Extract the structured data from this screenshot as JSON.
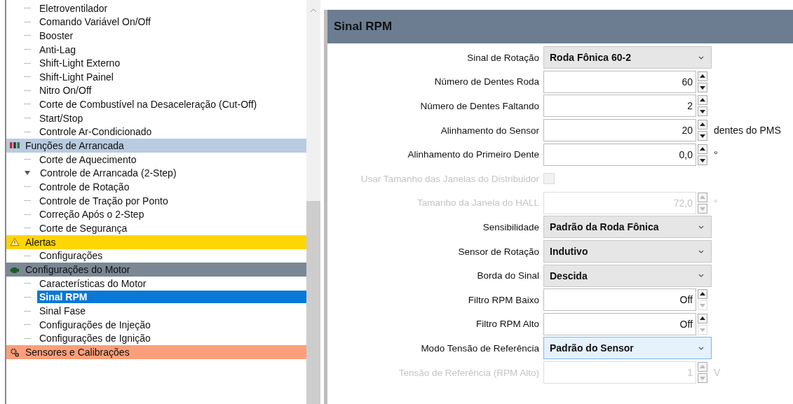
{
  "tree": [
    {
      "children": [
        {
          "label": "Eletroventilador",
          "expanded": false,
          "selected": false
        },
        {
          "label": "Comando Variável On/Off",
          "expanded": false,
          "selected": false
        },
        {
          "label": "Booster",
          "expanded": false,
          "selected": false
        },
        {
          "label": "Anti-Lag",
          "expanded": false,
          "selected": false
        },
        {
          "label": "Shift-Light Externo",
          "expanded": false,
          "selected": false
        },
        {
          "label": "Shift-Light Painel",
          "expanded": false,
          "selected": false
        },
        {
          "label": "Nitro On/Off",
          "expanded": false,
          "selected": false
        },
        {
          "label": "Corte de Combustível na Desaceleração (Cut-Off)",
          "expanded": false,
          "selected": false
        },
        {
          "label": "Start/Stop",
          "expanded": false,
          "selected": false
        },
        {
          "label": "Controle Ar-Condicionado",
          "expanded": false,
          "selected": false
        }
      ]
    },
    {
      "label": "Funções de Arrancada",
      "color": "#b9cbe0",
      "children": [
        {
          "label": "Corte de Aquecimento",
          "expanded": false,
          "selected": false
        },
        {
          "label": "Controle de Arrancada (2-Step)",
          "expanded": true,
          "selected": false
        },
        {
          "label": "Controle de Rotação",
          "expanded": false,
          "selected": false
        },
        {
          "label": "Controle de Tração por Ponto",
          "expanded": false,
          "selected": false
        },
        {
          "label": "Correção Após o 2-Step",
          "expanded": false,
          "selected": false
        },
        {
          "label": "Corte de Segurança",
          "expanded": false,
          "selected": false
        }
      ]
    },
    {
      "label": "Alertas",
      "color": "#fdd500",
      "children": [
        {
          "label": "Configurações",
          "expanded": false,
          "selected": false
        }
      ]
    },
    {
      "label": "Configurações do Motor",
      "color": "#7b8794",
      "children": [
        {
          "label": "Características do Motor",
          "expanded": false,
          "selected": false
        },
        {
          "label": "Sinal RPM",
          "expanded": false,
          "selected": true
        },
        {
          "label": "Sinal Fase",
          "expanded": false,
          "selected": false
        },
        {
          "label": "Configurações de Injeção",
          "expanded": false,
          "selected": false
        },
        {
          "label": "Configurações de Ignição",
          "expanded": false,
          "selected": false
        }
      ]
    },
    {
      "label": "Sensores e Calibrações",
      "color": "#fb9f7a"
    }
  ],
  "panel": {
    "title": "Sinal RPM",
    "rows": [
      {
        "kind": "select",
        "label": "Sinal de Rotação",
        "value": "Roda Fônica 60-2",
        "disabled": false,
        "focused": false
      },
      {
        "kind": "spin",
        "label": "Número de Dentes Roda",
        "value": "60",
        "disabled": false,
        "down_disabled": false
      },
      {
        "kind": "spin",
        "label": "Número de Dentes Faltando",
        "value": "2",
        "disabled": false,
        "down_disabled": false
      },
      {
        "kind": "spin",
        "label": "Alinhamento do Sensor",
        "value": "20",
        "unit": "dentes do PMS",
        "disabled": false,
        "down_disabled": false
      },
      {
        "kind": "spin",
        "label": "Alinhamento do Primeiro Dente",
        "value": "0,0",
        "unit": "°",
        "disabled": false,
        "down_disabled": false
      },
      {
        "kind": "checkbox",
        "label": "Usar Tamanho das Janelas do Distribuidor",
        "checked": false,
        "disabled": true
      },
      {
        "kind": "spin",
        "label": "Tamanho da Janela do HALL",
        "value": "72,0",
        "unit": "°",
        "disabled": true
      },
      {
        "kind": "select",
        "label": "Sensibilidade",
        "value": "Padrão da Roda Fônica",
        "disabled": false,
        "focused": false
      },
      {
        "kind": "select",
        "label": "Sensor de Rotação",
        "value": "Indutivo",
        "disabled": false,
        "focused": false
      },
      {
        "kind": "select",
        "label": "Borda do Sinal",
        "value": "Descida",
        "disabled": false,
        "focused": false
      },
      {
        "kind": "spin",
        "label": "Filtro RPM Baixo",
        "value": "Off",
        "disabled": false,
        "down_disabled": true
      },
      {
        "kind": "spin",
        "label": "Filtro RPM Alto",
        "value": "Off",
        "disabled": false,
        "down_disabled": true
      },
      {
        "kind": "select",
        "label": "Modo Tensão de Referência",
        "value": "Padrão do Sensor",
        "disabled": false,
        "focused": true
      },
      {
        "kind": "spin",
        "label": "Tensão de Referência (RPM Alto)",
        "value": "1",
        "unit": "V",
        "disabled": true
      }
    ]
  }
}
